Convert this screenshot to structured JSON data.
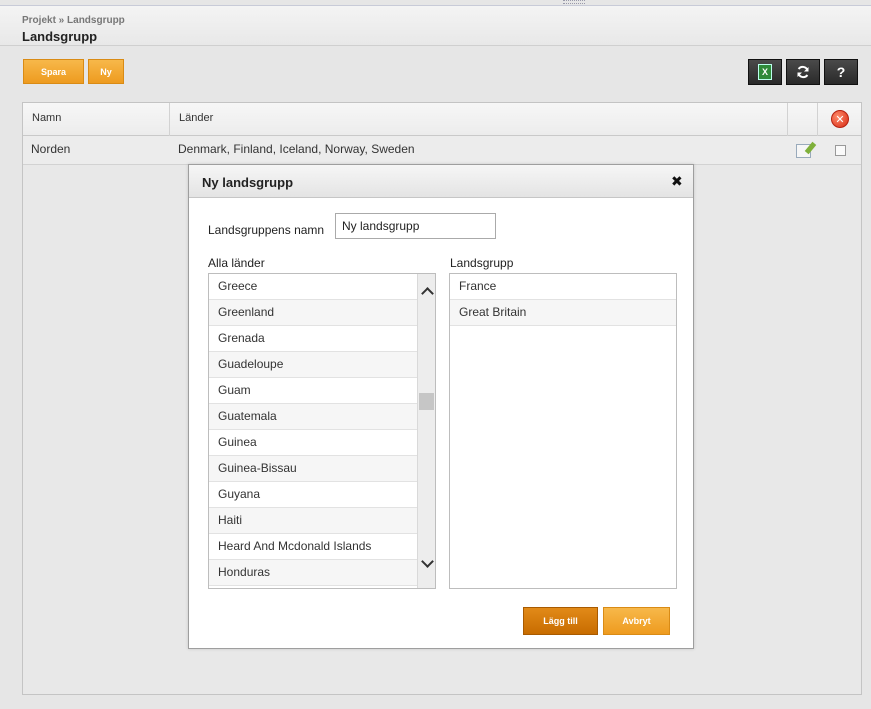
{
  "header": {
    "breadcrumb": "Projekt » Landsgrupp",
    "title": "Landsgrupp"
  },
  "toolbar": {
    "save_label": "Spara",
    "new_label": "Ny",
    "excel_icon": "excel-export-icon",
    "refresh_icon": "refresh-icon",
    "help_label": "?",
    "accent_color": "#ee9b1f"
  },
  "grid": {
    "columns": [
      "Namn",
      "Länder"
    ],
    "rows": [
      {
        "name": "Norden",
        "countries": "Denmark, Finland, Iceland, Norway, Sweden"
      }
    ]
  },
  "dialog": {
    "title": "Ny landsgrupp",
    "close_label": "✖",
    "name_label": "Landsgruppens namn",
    "name_value": "Ny landsgrupp",
    "all_countries_label": "Alla länder",
    "all_countries": [
      "Greece",
      "Greenland",
      "Grenada",
      "Guadeloupe",
      "Guam",
      "Guatemala",
      "Guinea",
      "Guinea-Bissau",
      "Guyana",
      "Haiti",
      "Heard And Mcdonald Islands",
      "Honduras"
    ],
    "group_label": "Landsgrupp",
    "group_countries": [
      "France",
      "Great Britain"
    ],
    "add_label": "Lägg till",
    "cancel_label": "Avbryt"
  }
}
